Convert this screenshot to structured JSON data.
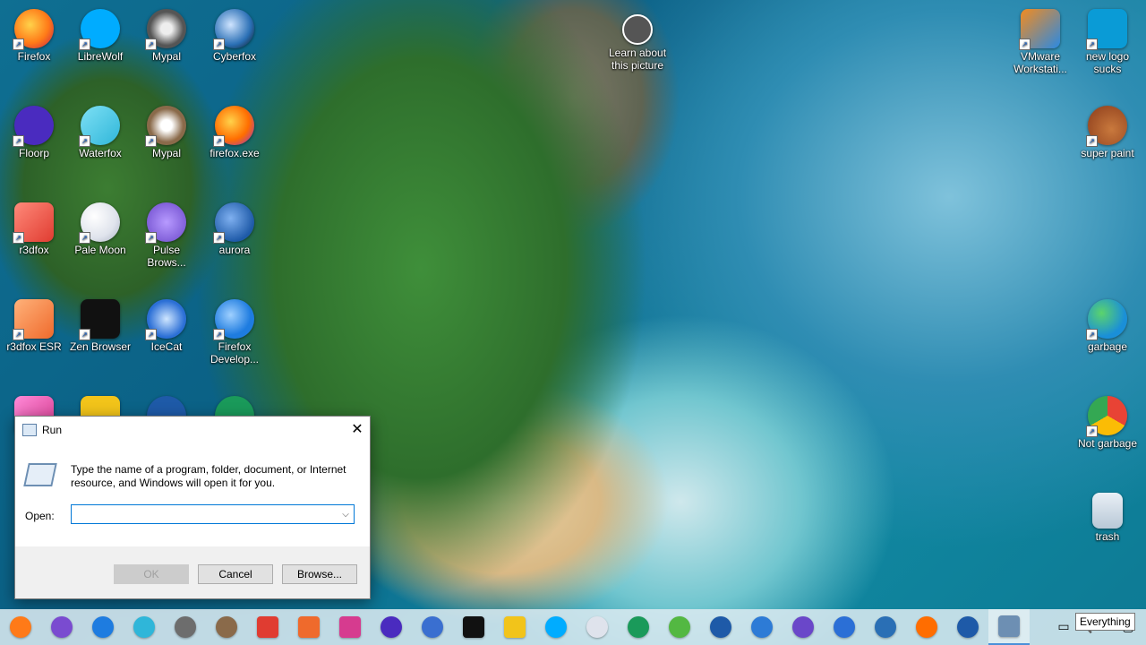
{
  "desktop": {
    "icons": [
      {
        "label": "Firefox",
        "color": "#ff7a18"
      },
      {
        "label": "LibreWolf",
        "color": "#00acff"
      },
      {
        "label": "Mypal",
        "color": "#6d6d6d"
      },
      {
        "label": "Cyberfox",
        "color": "#2a6fb5"
      },
      {
        "label": "Learn about this picture",
        "color": "#666666"
      },
      {
        "label": "VMware Workstati...",
        "color": "#2b8ae2"
      },
      {
        "label": "new logo sucks",
        "color": "#0a9bd6"
      },
      {
        "label": "Floorp",
        "color": "#4a2bbf"
      },
      {
        "label": "Waterfox",
        "color": "#2fb6d9"
      },
      {
        "label": "Mypal",
        "color": "#8a6a4a"
      },
      {
        "label": "firefox.exe",
        "color": "#ff6d00"
      },
      {
        "label": "super paint",
        "color": "#8b3b1a"
      },
      {
        "label": "r3dfox",
        "color": "#e03c31"
      },
      {
        "label": "Pale Moon",
        "color": "#dfe3ec"
      },
      {
        "label": "Pulse Brows...",
        "color": "#6a47c9"
      },
      {
        "label": "aurora",
        "color": "#1e5aa8"
      },
      {
        "label": "r3dfox ESR",
        "color": "#ef6a2c"
      },
      {
        "label": "Zen Browser",
        "color": "#111111"
      },
      {
        "label": "IceCat",
        "color": "#2b6fd6"
      },
      {
        "label": "Firefox Develop...",
        "color": "#1e7ce0"
      },
      {
        "label": "garbage",
        "color": "#1a8fd8"
      },
      {
        "label": "Not garbage",
        "color": "#e84335"
      },
      {
        "label": "trash",
        "color": "#b8c8d6"
      }
    ]
  },
  "run_dialog": {
    "title": "Run",
    "description": "Type the name of a program, folder, document, or Internet resource, and Windows will open it for you.",
    "open_label": "Open:",
    "open_value": "",
    "ok_label": "OK",
    "cancel_label": "Cancel",
    "browse_label": "Browse..."
  },
  "taskbar": {
    "apps": [
      {
        "name": "firefox",
        "color": "#ff7a18"
      },
      {
        "name": "firefox-nightly",
        "color": "#7a4bd0"
      },
      {
        "name": "firefox-dev",
        "color": "#1e7ce0"
      },
      {
        "name": "waterfox",
        "color": "#2fb6d9"
      },
      {
        "name": "mypal",
        "color": "#6d6d6d"
      },
      {
        "name": "mypal-2",
        "color": "#8a6a4a"
      },
      {
        "name": "r3dfox",
        "color": "#e03c31"
      },
      {
        "name": "r3dfox-esr",
        "color": "#ef6a2c"
      },
      {
        "name": "midori",
        "color": "#d63b8f"
      },
      {
        "name": "floorp",
        "color": "#4a2bbf"
      },
      {
        "name": "u-browser",
        "color": "#3a6fd0"
      },
      {
        "name": "zen",
        "color": "#111111"
      },
      {
        "name": "m-browser",
        "color": "#f2c41a"
      },
      {
        "name": "librewolf",
        "color": "#00acff"
      },
      {
        "name": "pale-moon",
        "color": "#dfe3ec"
      },
      {
        "name": "kmeleon",
        "color": "#1a9a5a"
      },
      {
        "name": "chromium-like",
        "color": "#53b842"
      },
      {
        "name": "aurora",
        "color": "#1e5aa8"
      },
      {
        "name": "basilisk",
        "color": "#2d7bd6"
      },
      {
        "name": "pulse",
        "color": "#6a47c9"
      },
      {
        "name": "icecat",
        "color": "#2b6fd6"
      },
      {
        "name": "cyberfox",
        "color": "#2a6fb5"
      },
      {
        "name": "firefox-2",
        "color": "#ff6d00"
      },
      {
        "name": "firefox-3",
        "color": "#1e5aa8"
      },
      {
        "name": "run",
        "color": "#6d8fb3"
      }
    ],
    "tooltip": "Everything"
  }
}
